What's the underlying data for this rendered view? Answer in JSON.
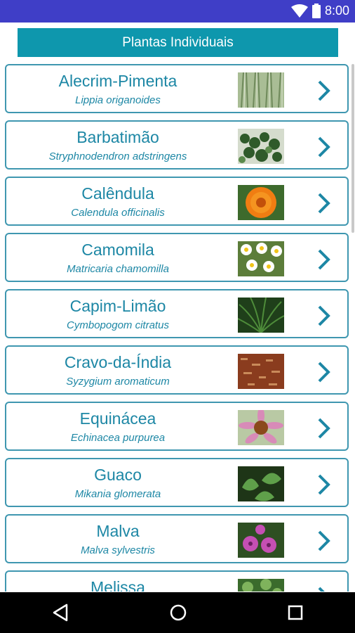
{
  "status": {
    "time": "8:00",
    "icons": [
      "wifi-icon",
      "battery-icon"
    ]
  },
  "header": {
    "title": "Plantas Individuais"
  },
  "accent_color": "#0e97ad",
  "items": [
    {
      "name": "Alecrim-Pimenta",
      "scientific": "Lippia origanoides",
      "thumb": "alecrim"
    },
    {
      "name": "Barbatimão",
      "scientific": "Stryphnodendron adstringens",
      "thumb": "barbatimao"
    },
    {
      "name": "Calêndula",
      "scientific": "Calendula officinalis",
      "thumb": "calendula"
    },
    {
      "name": "Camomila",
      "scientific": "Matricaria chamomilla",
      "thumb": "camomila"
    },
    {
      "name": "Capim-Limão",
      "scientific": "Cymbopogom citratus",
      "thumb": "capim"
    },
    {
      "name": "Cravo-da-Índia",
      "scientific": "Syzygium aromaticum",
      "thumb": "cravo"
    },
    {
      "name": "Equinácea",
      "scientific": "Echinacea purpurea",
      "thumb": "equinacea"
    },
    {
      "name": "Guaco",
      "scientific": "Mikania glomerata",
      "thumb": "guaco"
    },
    {
      "name": "Malva",
      "scientific": "Malva sylvestris",
      "thumb": "malva"
    },
    {
      "name": "Melissa",
      "scientific": "",
      "thumb": "melissa"
    }
  ],
  "navbar": {
    "buttons": [
      "back-icon",
      "home-icon",
      "recents-icon"
    ]
  }
}
